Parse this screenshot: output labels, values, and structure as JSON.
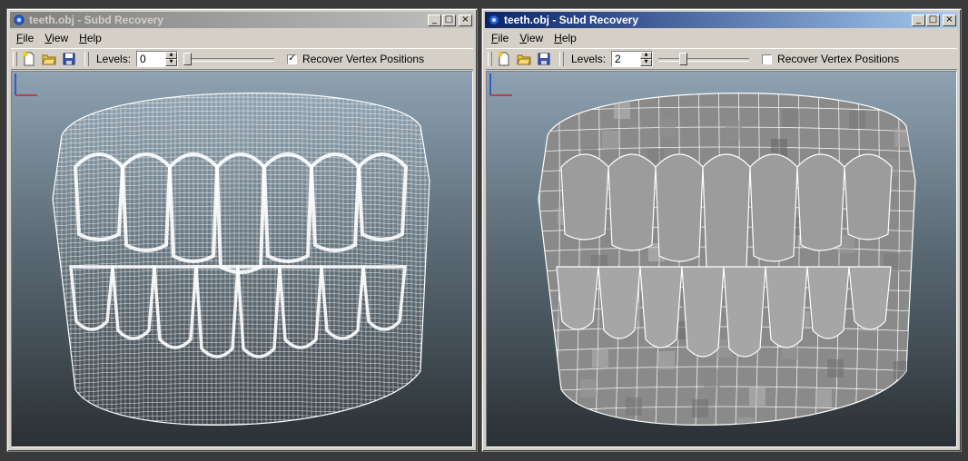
{
  "windows": [
    {
      "id": "left",
      "title": "teeth.obj - Subd Recovery",
      "active": false,
      "menu": [
        "File",
        "View",
        "Help"
      ],
      "toolbar": {
        "levels_label": "Levels:",
        "levels_value": "0",
        "slider_fraction": 0.0,
        "checkbox_label": "Recover Vertex Positions",
        "checkbox_checked": true
      },
      "viewport": {
        "render": "dense-wireframe",
        "model": "teeth"
      }
    },
    {
      "id": "right",
      "title": "teeth.obj - Subd Recovery",
      "active": true,
      "menu": [
        "File",
        "View",
        "Help"
      ],
      "toolbar": {
        "levels_label": "Levels:",
        "levels_value": "2",
        "slider_fraction": 0.25,
        "checkbox_label": "Recover Vertex Positions",
        "checkbox_checked": false
      },
      "viewport": {
        "render": "coarse-shaded-mesh",
        "model": "teeth"
      }
    }
  ],
  "icons": {
    "app": "gear-icon",
    "new": "new-file-icon",
    "open": "open-folder-icon",
    "save": "save-icon",
    "minimize": "minimize-icon",
    "maximize": "maximize-icon",
    "close": "close-icon",
    "axis": "axis-gizmo-icon"
  },
  "colors": {
    "title_active_start": "#0a246a",
    "title_active_end": "#a6caf0",
    "title_inactive_start": "#808080",
    "title_inactive_end": "#c0c0c0",
    "chrome": "#d4d0c8",
    "viewport_top": "#8ea2b2",
    "viewport_bottom": "#2a3034",
    "wire_dense": "#ffffff",
    "mesh_fill": "#a0a0a0"
  }
}
